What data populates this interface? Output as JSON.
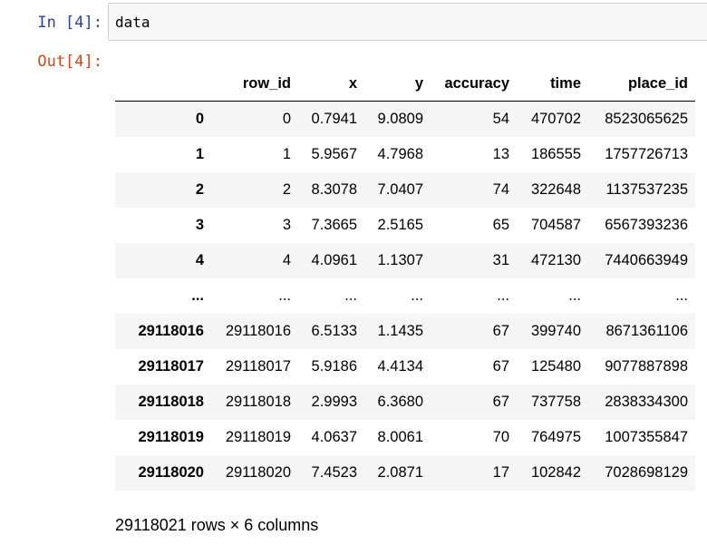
{
  "input_prompt": "In  [4]:",
  "output_prompt": "Out[4]:",
  "code": "data",
  "table": {
    "columns": [
      "",
      "row_id",
      "x",
      "y",
      "accuracy",
      "time",
      "place_id"
    ],
    "rows": [
      [
        "0",
        "0",
        "0.7941",
        "9.0809",
        "54",
        "470702",
        "8523065625"
      ],
      [
        "1",
        "1",
        "5.9567",
        "4.7968",
        "13",
        "186555",
        "1757726713"
      ],
      [
        "2",
        "2",
        "8.3078",
        "7.0407",
        "74",
        "322648",
        "1137537235"
      ],
      [
        "3",
        "3",
        "7.3665",
        "2.5165",
        "65",
        "704587",
        "6567393236"
      ],
      [
        "4",
        "4",
        "4.0961",
        "1.1307",
        "31",
        "472130",
        "7440663949"
      ],
      [
        "...",
        "...",
        "...",
        "...",
        "...",
        "...",
        "..."
      ],
      [
        "29118016",
        "29118016",
        "6.5133",
        "1.1435",
        "67",
        "399740",
        "8671361106"
      ],
      [
        "29118017",
        "29118017",
        "5.9186",
        "4.4134",
        "67",
        "125480",
        "9077887898"
      ],
      [
        "29118018",
        "29118018",
        "2.9993",
        "6.3680",
        "67",
        "737758",
        "2838334300"
      ],
      [
        "29118019",
        "29118019",
        "4.0637",
        "8.0061",
        "70",
        "764975",
        "1007355847"
      ],
      [
        "29118020",
        "29118020",
        "7.4523",
        "2.0871",
        "17",
        "102842",
        "7028698129"
      ]
    ]
  },
  "summary": "29118021 rows × 6 columns"
}
